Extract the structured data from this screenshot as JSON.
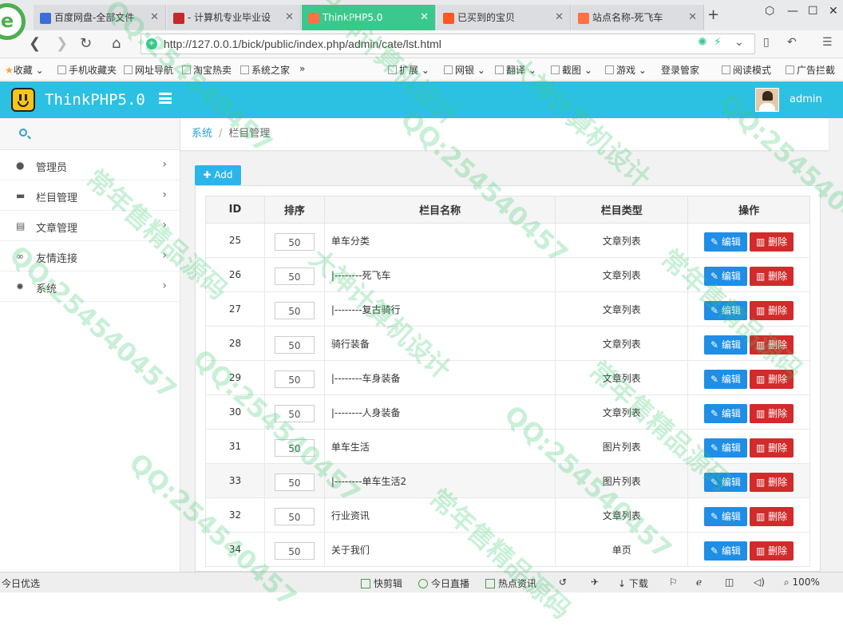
{
  "browser": {
    "tabs": [
      {
        "label": "百度网盘-全部文件",
        "active": false,
        "color": "#3a6fd8"
      },
      {
        "label": "- 计算机专业毕业设",
        "active": false,
        "color": "#c62828"
      },
      {
        "label": "ThinkPHP5.0",
        "active": true,
        "color": "#ff7043"
      },
      {
        "label": "已买到的宝贝",
        "active": false,
        "color": "#ff5722"
      },
      {
        "label": "站点名称-死飞车",
        "active": false,
        "color": "#ff7043"
      }
    ],
    "url": "http://127.0.0.1/bick/public/index.php/admin/cate/lst.html",
    "bookmarks": [
      "收藏",
      "手机收藏夹",
      "网址导航",
      "淘宝热卖",
      "系统之家",
      "»",
      "扩展",
      "网银",
      "翻译",
      "截图",
      "游戏",
      "登录管家",
      "阅读模式",
      "广告拦截"
    ]
  },
  "app": {
    "brand": "ThinkPHP5.0",
    "user": "admin",
    "accent": "#2cc1e3"
  },
  "sidebar": {
    "items": [
      {
        "label": "管理员",
        "icon": "user-icon"
      },
      {
        "label": "栏目管理",
        "icon": "folder-icon"
      },
      {
        "label": "文章管理",
        "icon": "document-icon"
      },
      {
        "label": "友情连接",
        "icon": "link-icon"
      },
      {
        "label": "系统",
        "icon": "gear-icon"
      }
    ]
  },
  "breadcrumb": {
    "root": "系统",
    "current": "栏目管理"
  },
  "toolbar": {
    "add_label": "Add"
  },
  "table": {
    "headers": [
      "ID",
      "排序",
      "栏目名称",
      "栏目类型",
      "操作"
    ],
    "edit_label": "编辑",
    "delete_label": "删除",
    "rows": [
      {
        "id": "25",
        "sort": "50",
        "name": "单车分类",
        "type": "文章列表"
      },
      {
        "id": "26",
        "sort": "50",
        "name": "|--------死飞车",
        "type": "文章列表"
      },
      {
        "id": "27",
        "sort": "50",
        "name": "|--------复古骑行",
        "type": "文章列表"
      },
      {
        "id": "28",
        "sort": "50",
        "name": "骑行装备",
        "type": "文章列表"
      },
      {
        "id": "29",
        "sort": "50",
        "name": "|--------车身装备",
        "type": "文章列表"
      },
      {
        "id": "30",
        "sort": "50",
        "name": "|--------人身装备",
        "type": "文章列表"
      },
      {
        "id": "31",
        "sort": "50",
        "name": "单车生活",
        "type": "图片列表"
      },
      {
        "id": "33",
        "sort": "50",
        "name": "|--------单车生活2",
        "type": "图片列表"
      },
      {
        "id": "32",
        "sort": "50",
        "name": "行业资讯",
        "type": "文章列表"
      },
      {
        "id": "34",
        "sort": "50",
        "name": "关于我们",
        "type": "单页"
      }
    ]
  },
  "statusbar": {
    "left": "今日优选",
    "items": [
      "快剪辑",
      "今日直播",
      "热点资讯",
      "下载"
    ],
    "zoom": "100%"
  },
  "watermarks": [
    "QQ:254540457",
    "大神计算机设计",
    "常年售精品源码"
  ]
}
